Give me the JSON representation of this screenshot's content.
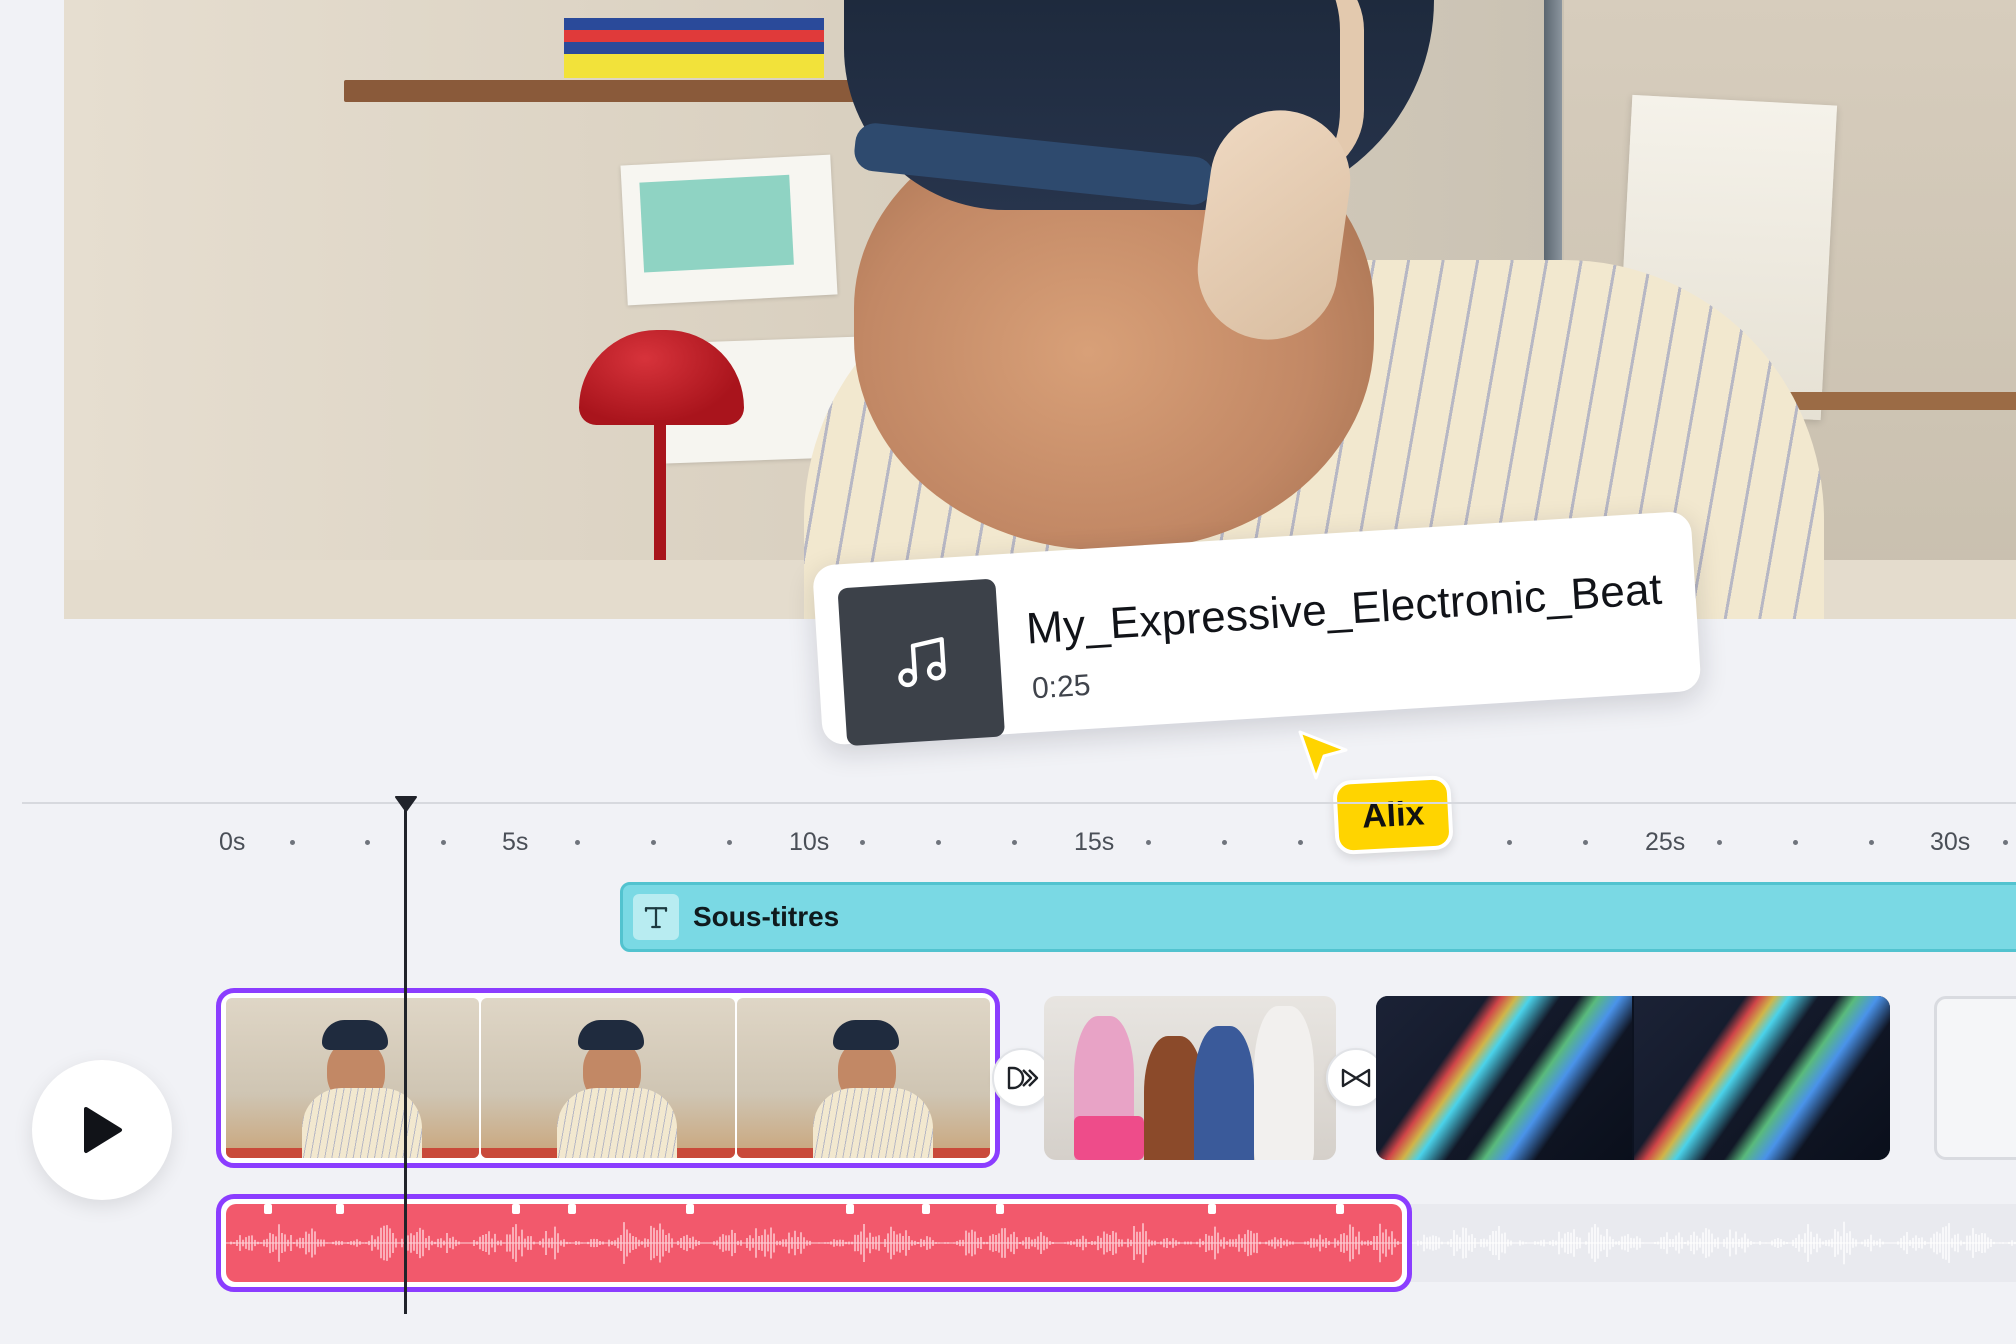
{
  "audio_card": {
    "title": "My_Expressive_Electronic_Beat",
    "duration": "0:25",
    "icon": "music-note-icon"
  },
  "collaborator": {
    "name": "Alix",
    "color": "#ffd400"
  },
  "ruler": {
    "labels": [
      "0s",
      "5s",
      "10s",
      "15s",
      "25s",
      "30s"
    ]
  },
  "caption_track": {
    "label": "Sous-titres",
    "icon": "text-icon",
    "color": "#7ad9e4"
  },
  "transitions": {
    "first": "dissolve-transition-icon",
    "second": "bowtie-transition-icon"
  },
  "controls": {
    "play_icon": "play-icon"
  },
  "colors": {
    "selection": "#8b3dff",
    "audio": "#f2596c"
  }
}
